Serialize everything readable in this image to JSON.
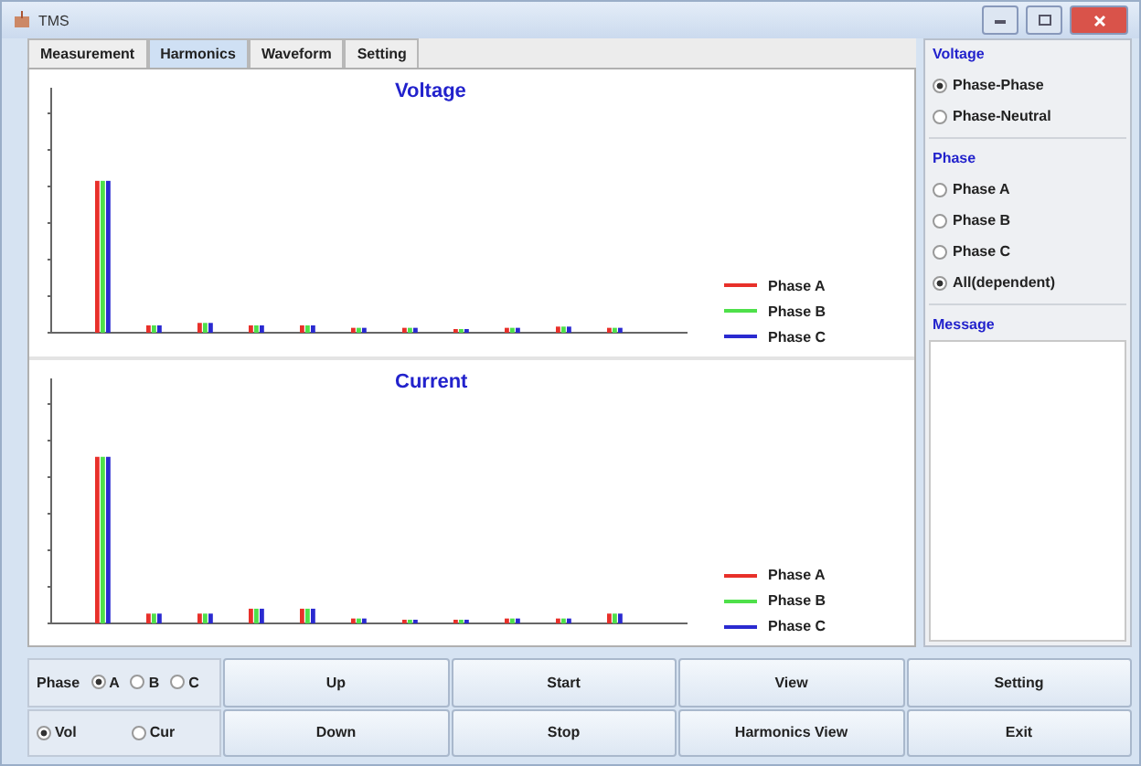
{
  "window": {
    "title": "TMS"
  },
  "tabs": [
    {
      "label": "Measurement",
      "selected": false
    },
    {
      "label": "Harmonics",
      "selected": true
    },
    {
      "label": "Waveform",
      "selected": false
    },
    {
      "label": "Setting",
      "selected": false
    }
  ],
  "charts": [
    {
      "title": "Voltage",
      "legend": [
        {
          "label": "Phase A",
          "color": "#e8302a"
        },
        {
          "label": "Phase B",
          "color": "#4ee04a"
        },
        {
          "label": "Phase C",
          "color": "#2a2ad0"
        }
      ]
    },
    {
      "title": "Current",
      "legend": [
        {
          "label": "Phase A",
          "color": "#e8302a"
        },
        {
          "label": "Phase B",
          "color": "#4ee04a"
        },
        {
          "label": "Phase C",
          "color": "#2a2ad0"
        }
      ]
    }
  ],
  "side_panel": {
    "groups": [
      {
        "title": "Voltage",
        "options": [
          {
            "label": "Phase-Phase",
            "selected": true
          },
          {
            "label": "Phase-Neutral",
            "selected": false
          }
        ]
      },
      {
        "title": "Phase",
        "options": [
          {
            "label": "Phase A",
            "selected": false
          },
          {
            "label": "Phase B",
            "selected": false
          },
          {
            "label": "Phase C",
            "selected": false
          },
          {
            "label": "All(dependent)",
            "selected": true
          }
        ]
      }
    ],
    "message_title": "Message"
  },
  "controls": {
    "phase_label": "Phase",
    "phase_options": [
      {
        "label": "A",
        "selected": true
      },
      {
        "label": "B",
        "selected": false
      },
      {
        "label": "C",
        "selected": false
      }
    ],
    "signal_options": [
      {
        "label": "Vol",
        "selected": true
      },
      {
        "label": "Cur",
        "selected": false
      }
    ]
  },
  "buttons": [
    [
      "Up",
      "Down"
    ],
    [
      "Start",
      "Stop"
    ],
    [
      "View",
      "Harmonics View"
    ],
    [
      "Setting",
      "Exit"
    ]
  ]
}
